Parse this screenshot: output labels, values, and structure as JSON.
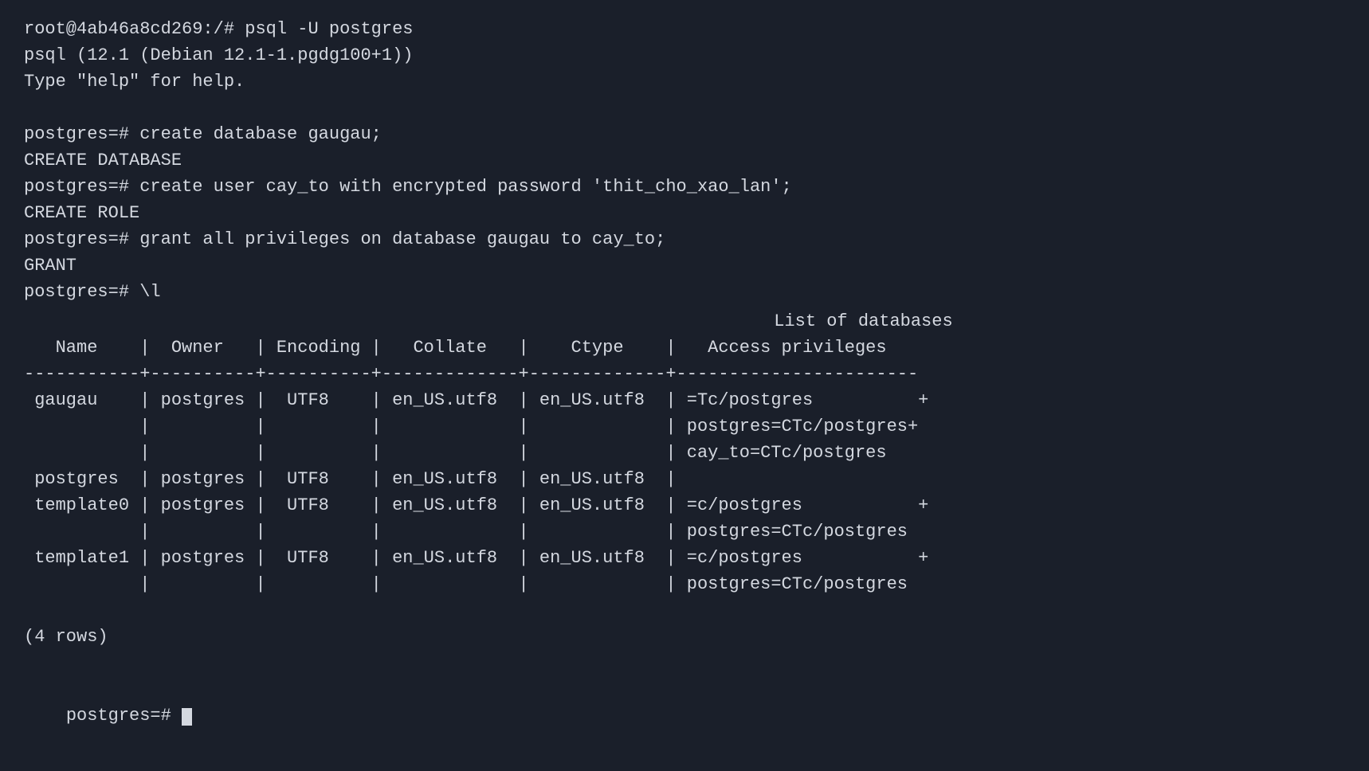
{
  "terminal": {
    "bg_color": "#1a1f2a",
    "fg_color": "#d4d8e0",
    "lines": [
      {
        "id": "l1",
        "text": "root@4ab46a8cd269:/# psql -U postgres"
      },
      {
        "id": "l2",
        "text": "psql (12.1 (Debian 12.1-1.pgdg100+1))"
      },
      {
        "id": "l3",
        "text": "Type \"help\" for help."
      },
      {
        "id": "l4",
        "text": ""
      },
      {
        "id": "l5",
        "text": "postgres=# create database gaugau;"
      },
      {
        "id": "l6",
        "text": "CREATE DATABASE"
      },
      {
        "id": "l7",
        "text": "postgres=# create user cay_to with encrypted password 'thit_cho_xao_lan';"
      },
      {
        "id": "l8",
        "text": "CREATE ROLE"
      },
      {
        "id": "l9",
        "text": "postgres=# grant all privileges on database gaugau to cay_to;"
      },
      {
        "id": "l10",
        "text": "GRANT"
      },
      {
        "id": "l11",
        "text": "postgres=# \\l"
      }
    ],
    "table_title": "                                  List of databases",
    "table_header": "   Name    |  Owner   | Encoding |   Collate   |    Ctype    |   Access privileges   ",
    "table_separator": "-----------+----------+----------+-------------+-------------+-----------------------",
    "table_rows": [
      " gaugau    | postgres |  UTF8    | en_US.utf8  | en_US.utf8  | =Tc/postgres          +",
      "           |          |          |             |             | postgres=CTc/postgres+",
      "           |          |          |             |             | cay_to=CTc/postgres   ",
      " postgres  | postgres |  UTF8    | en_US.utf8  | en_US.utf8  |                       ",
      " template0 | postgres |  UTF8    | en_US.utf8  | en_US.utf8  | =c/postgres           +",
      "           |          |          |             |             | postgres=CTc/postgres ",
      " template1 | postgres |  UTF8    | en_US.utf8  | en_US.utf8  | =c/postgres           +",
      "           |          |          |             |             | postgres=CTc/postgres "
    ],
    "rows_count": "(4 rows)",
    "final_prompt": "postgres=# "
  }
}
